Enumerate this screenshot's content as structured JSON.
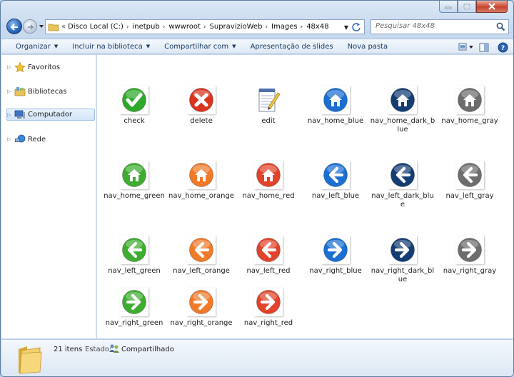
{
  "window": {
    "caption_buttons": [
      "minimize-icon",
      "maximize-icon",
      "close-icon"
    ]
  },
  "address": {
    "breadcrumbs": [
      "Disco Local (C:)",
      "inetpub",
      "wwwroot",
      "SupravizioWeb",
      "Images",
      "48x48"
    ],
    "search_placeholder": "Pesquisar 48x48"
  },
  "toolbar": {
    "organize": "Organizar",
    "include_library": "Incluir na biblioteca",
    "share_with": "Compartilhar com",
    "slideshow": "Apresentação de slides",
    "new_folder": "Nova pasta"
  },
  "nav": {
    "items": [
      {
        "label": "Favoritos",
        "icon": "star-icon"
      },
      {
        "label": "Bibliotecas",
        "icon": "libraries-icon"
      },
      {
        "label": "Computador",
        "icon": "computer-icon"
      },
      {
        "label": "Rede",
        "icon": "network-icon"
      }
    ]
  },
  "files": [
    {
      "name": "check",
      "kind": "check",
      "color": "#2ea82a"
    },
    {
      "name": "delete",
      "kind": "delete",
      "color": "#d9341f"
    },
    {
      "name": "edit",
      "kind": "edit",
      "color": "#5a6fa8"
    },
    {
      "name": "nav_home_blue",
      "kind": "home",
      "color": "#1b6fd1"
    },
    {
      "name": "nav_home_dark_blue",
      "kind": "home",
      "color": "#143d73"
    },
    {
      "name": "nav_home_gray",
      "kind": "home",
      "color": "#6d6d6d"
    },
    {
      "name": "nav_home_green",
      "kind": "home",
      "color": "#3dad2f"
    },
    {
      "name": "nav_home_orange",
      "kind": "home",
      "color": "#f07a2a"
    },
    {
      "name": "nav_home_red",
      "kind": "home",
      "color": "#e2432a"
    },
    {
      "name": "nav_left_blue",
      "kind": "left",
      "color": "#1b6fd1"
    },
    {
      "name": "nav_left_dark_blue",
      "kind": "left",
      "color": "#143d73"
    },
    {
      "name": "nav_left_gray",
      "kind": "left",
      "color": "#6d6d6d"
    },
    {
      "name": "nav_left_green",
      "kind": "left",
      "color": "#3dad2f"
    },
    {
      "name": "nav_left_orange",
      "kind": "left",
      "color": "#f07a2a"
    },
    {
      "name": "nav_left_red",
      "kind": "left",
      "color": "#e2432a"
    },
    {
      "name": "nav_right_blue",
      "kind": "right",
      "color": "#1b6fd1"
    },
    {
      "name": "nav_right_dark_blue",
      "kind": "right",
      "color": "#143d73"
    },
    {
      "name": "nav_right_gray",
      "kind": "right",
      "color": "#6d6d6d"
    },
    {
      "name": "nav_right_green",
      "kind": "right",
      "color": "#3dad2f"
    },
    {
      "name": "nav_right_orange",
      "kind": "right",
      "color": "#f07a2a"
    },
    {
      "name": "nav_right_red",
      "kind": "right",
      "color": "#e2432a"
    }
  ],
  "status": {
    "count": "21 itens",
    "state_label": "Estado:",
    "state_value": "Compartilhado"
  }
}
